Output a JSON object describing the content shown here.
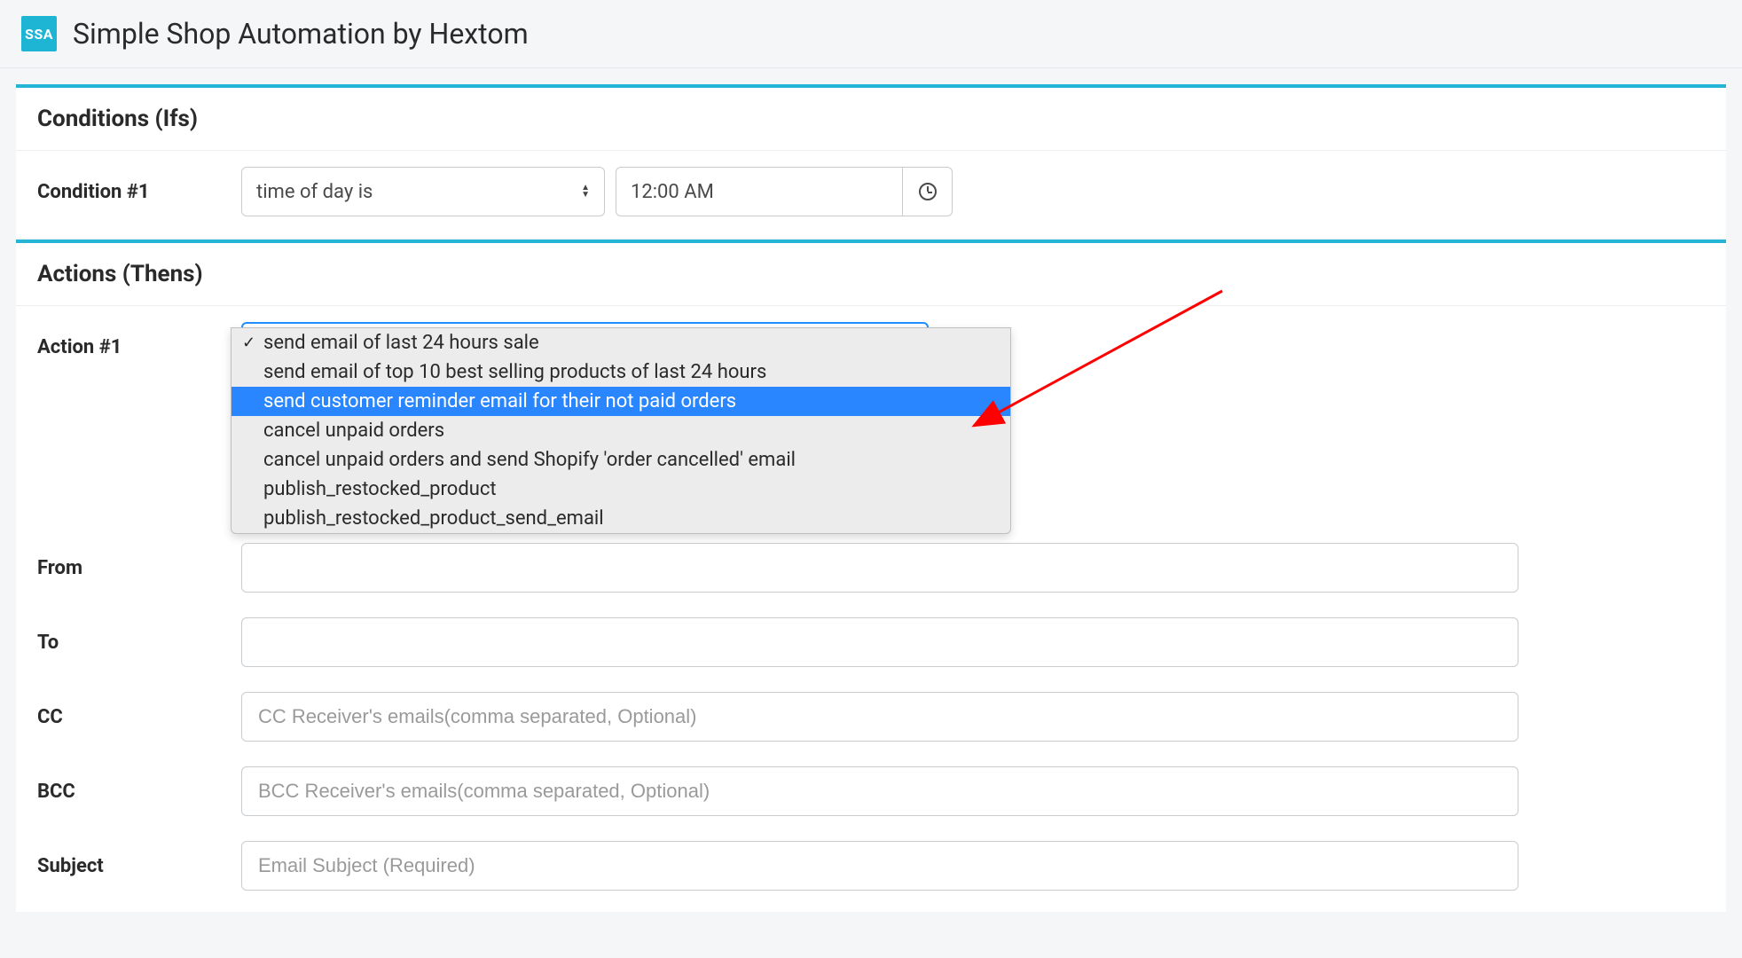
{
  "header": {
    "logo_text": "SSA",
    "title": "Simple Shop Automation by Hextom"
  },
  "conditions": {
    "title": "Conditions (Ifs)",
    "rows": [
      {
        "label": "Condition #1",
        "select_value": "time of day is",
        "time_value": "12:00 AM"
      }
    ]
  },
  "actions": {
    "title": "Actions (Thens)",
    "row_label": "Action #1",
    "dropdown_options": [
      {
        "label": "send email of last 24 hours sale",
        "checked": true,
        "highlighted": false
      },
      {
        "label": "send email of top 10 best selling products of last 24 hours",
        "checked": false,
        "highlighted": false
      },
      {
        "label": "send customer reminder email for their not paid orders",
        "checked": false,
        "highlighted": true
      },
      {
        "label": "cancel unpaid orders",
        "checked": false,
        "highlighted": false
      },
      {
        "label": "cancel unpaid orders and send Shopify 'order cancelled' email",
        "checked": false,
        "highlighted": false
      },
      {
        "label": "publish_restocked_product",
        "checked": false,
        "highlighted": false
      },
      {
        "label": "publish_restocked_product_send_email",
        "checked": false,
        "highlighted": false
      }
    ],
    "fields": {
      "from": {
        "label": "From",
        "placeholder": ""
      },
      "to": {
        "label": "To",
        "placeholder": ""
      },
      "cc": {
        "label": "CC",
        "placeholder": "CC Receiver's emails(comma separated, Optional)"
      },
      "bcc": {
        "label": "BCC",
        "placeholder": "BCC Receiver's emails(comma separated, Optional)"
      },
      "subject": {
        "label": "Subject",
        "placeholder": "Email Subject (Required)"
      }
    }
  }
}
